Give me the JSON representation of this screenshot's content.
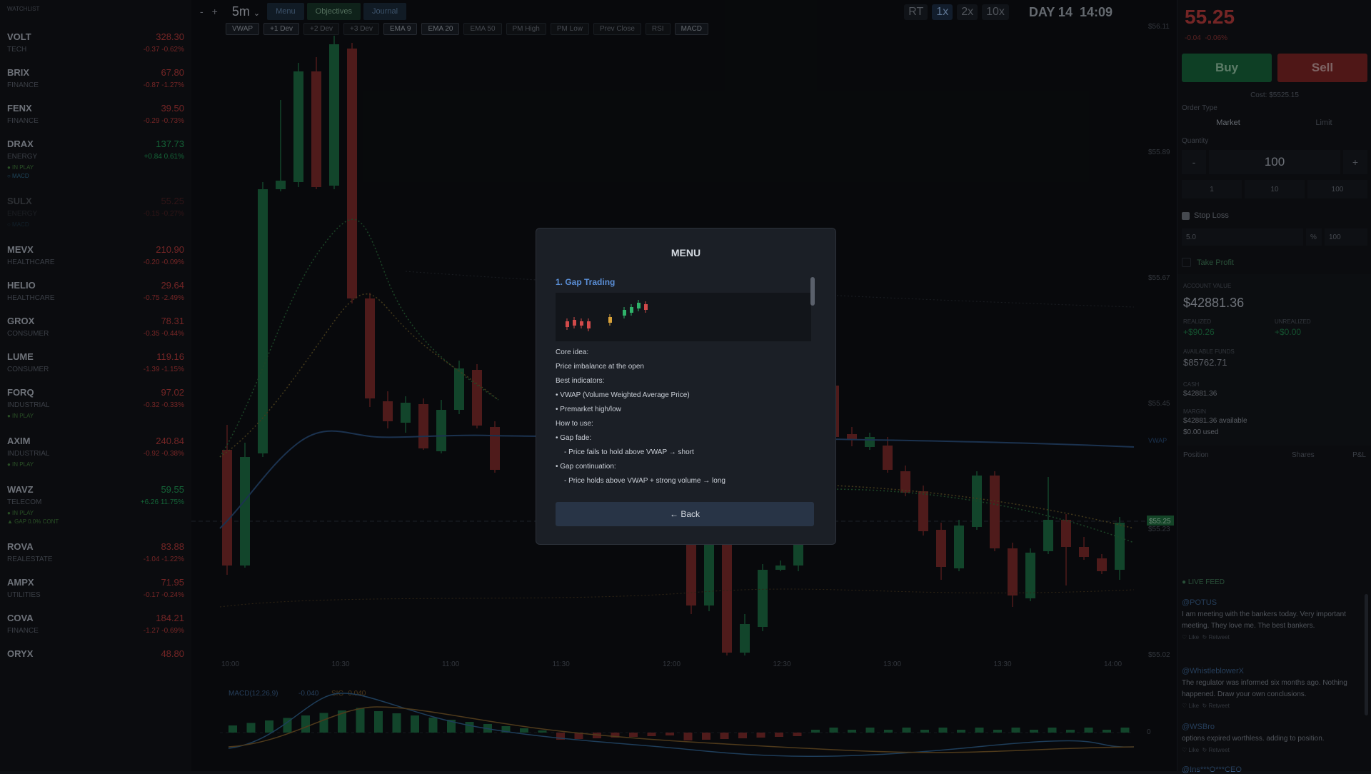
{
  "watchlist": {
    "header": "WATCHLIST",
    "items": [
      {
        "symbol": "VOLT",
        "sector": "TECH",
        "price": "328.30",
        "change": "-0.37 -0.62%",
        "dir": "down",
        "tags": []
      },
      {
        "symbol": "BRIX",
        "sector": "FINANCE",
        "price": "67.80",
        "change": "-0.87 -1.27%",
        "dir": "down",
        "tags": []
      },
      {
        "symbol": "FENX",
        "sector": "FINANCE",
        "price": "39.50",
        "change": "-0.29 -0.73%",
        "dir": "down",
        "tags": []
      },
      {
        "symbol": "DRAX",
        "sector": "ENERGY",
        "price": "137.73",
        "change": "+0.84 0.61%",
        "dir": "up",
        "tags": [
          "● IN PLAY",
          "○ MACD"
        ]
      },
      {
        "symbol": "SULX",
        "sector": "ENERGY",
        "price": "55.25",
        "change": "-0.15 -0.27%",
        "dir": "down",
        "tags": [
          "○ MACD"
        ],
        "selected": true
      },
      {
        "symbol": "MEVX",
        "sector": "HEALTHCARE",
        "price": "210.90",
        "change": "-0.20 -0.09%",
        "dir": "down",
        "tags": []
      },
      {
        "symbol": "HELIO",
        "sector": "HEALTHCARE",
        "price": "29.64",
        "change": "-0.75 -2.49%",
        "dir": "down",
        "tags": []
      },
      {
        "symbol": "GROX",
        "sector": "CONSUMER",
        "price": "78.31",
        "change": "-0.35 -0.44%",
        "dir": "down",
        "tags": []
      },
      {
        "symbol": "LUME",
        "sector": "CONSUMER",
        "price": "119.16",
        "change": "-1.39 -1.15%",
        "dir": "down",
        "tags": []
      },
      {
        "symbol": "FORQ",
        "sector": "INDUSTRIAL",
        "price": "97.02",
        "change": "-0.32 -0.33%",
        "dir": "down",
        "tags": [
          "● IN PLAY"
        ]
      },
      {
        "symbol": "AXIM",
        "sector": "INDUSTRIAL",
        "price": "240.84",
        "change": "-0.92 -0.38%",
        "dir": "down",
        "tags": [
          "● IN PLAY"
        ]
      },
      {
        "symbol": "WAVZ",
        "sector": "TELECOM",
        "price": "59.55",
        "change": "+6.26 11.75%",
        "dir": "up",
        "tags": [
          "● IN PLAY",
          "▲ GAP 0.0% CONT"
        ]
      },
      {
        "symbol": "ROVA",
        "sector": "REALESTATE",
        "price": "83.88",
        "change": "-1.04 -1.22%",
        "dir": "down",
        "tags": []
      },
      {
        "symbol": "AMPX",
        "sector": "UTILITIES",
        "price": "71.95",
        "change": "-0.17 -0.24%",
        "dir": "down",
        "tags": []
      },
      {
        "symbol": "COVA",
        "sector": "FINANCE",
        "price": "184.21",
        "change": "-1.27 -0.69%",
        "dir": "down",
        "tags": []
      },
      {
        "symbol": "ORYX",
        "sector": "",
        "price": "48.80",
        "change": "",
        "dir": "down",
        "tags": []
      }
    ]
  },
  "toolbar": {
    "minus": "-",
    "plus": "+",
    "timeframe": "5m",
    "tabs": [
      "Menu",
      "Objectives",
      "Journal"
    ],
    "indicators": [
      "VWAP",
      "+1 Dev",
      "+2 Dev",
      "+3 Dev",
      "EMA 9",
      "EMA 20",
      "EMA 50",
      "PM High",
      "PM Low",
      "Prev Close",
      "RSI",
      "MACD"
    ],
    "speeds": [
      "RT",
      "1x",
      "2x",
      "10x"
    ],
    "day": "DAY 14  14:09"
  },
  "chart": {
    "price_labels": [
      "$56.11",
      "$55.89",
      "$55.67",
      "$55.45",
      "$55.23",
      "$55.02"
    ],
    "current_price_tag": "$55.25",
    "vwap_label": "VWAP",
    "time_labels": [
      "10:00",
      "10:30",
      "11:00",
      "11:30",
      "12:00",
      "12:30",
      "13:00",
      "13:30",
      "14:00"
    ],
    "macd_label": "MACD(12,26,9)",
    "macd_value": "-0.040",
    "sig_value": "SIG -0.040",
    "zero_label": "0",
    "colors": {
      "up": "#1c6b43",
      "down": "#7a2a2a",
      "vwap": "#2a4d7a",
      "ema_up": "#2c6a3c",
      "ema_red": "#7a3a2a"
    }
  },
  "panel": {
    "price": "55.25",
    "change": "-0.04  -0.06%",
    "buy": "Buy",
    "sell": "Sell",
    "cost": "Cost: $5525.15",
    "order_type_label": "Order Type",
    "order_types": [
      "Market",
      "Limit"
    ],
    "quantity_label": "Quantity",
    "qty_minus": "-",
    "qty_value": "100",
    "qty_plus": "+",
    "presets": [
      "1",
      "10",
      "100"
    ],
    "stop_loss": "Stop Loss",
    "sl_value": "5.0",
    "sl_unit": "%",
    "sl_qty": "100",
    "take_profit": "Take Profit",
    "account": {
      "value_label": "ACCOUNT VALUE",
      "value": "$42881.36",
      "realized_label": "REALIZED",
      "realized": "+$90.26",
      "unrealized_label": "UNREALIZED",
      "unrealized": "+$0.00",
      "funds_label": "AVAILABLE FUNDS",
      "funds": "$85762.71",
      "cash_label": "CASH",
      "cash": "$42881.36",
      "margin_label": "MARGIN",
      "margin_avail": "$42881.36 available",
      "margin_used": "$0.00 used"
    },
    "position_headers": [
      "Position",
      "Shares",
      "P&L"
    ],
    "feed_header": "● LIVE FEED",
    "feed": [
      {
        "user": "@POTUS",
        "text": "I am meeting with the bankers today. Very important meeting. They love me. The best bankers.",
        "like": "♡ Like",
        "retweet": "↻ Retweet"
      },
      {
        "user": "@WhistleblowerX",
        "text": "The regulator was informed six months ago. Nothing happened. Draw your own conclusions.",
        "like": "♡ Like",
        "retweet": "↻ Retweet"
      },
      {
        "user": "@WSBro",
        "text": "options expired worthless. adding to position.",
        "like": "♡ Like",
        "retweet": "↻ Retweet"
      },
      {
        "user": "@Ins***O***CEO",
        "text": "",
        "like": "",
        "retweet": ""
      }
    ]
  },
  "modal": {
    "title": "MENU",
    "section_title": "1. Gap Trading",
    "lines": [
      {
        "t": "Core idea:",
        "sub": false
      },
      {
        "t": "Price imbalance at the open",
        "sub": false
      },
      {
        "t": "Best indicators:",
        "sub": false
      },
      {
        "t": "• VWAP (Volume Weighted Average Price)",
        "sub": false
      },
      {
        "t": "• Premarket high/low",
        "sub": false
      },
      {
        "t": "How to use:",
        "sub": false
      },
      {
        "t": "• Gap fade:",
        "sub": false
      },
      {
        "t": "- Price fails to hold above VWAP → short",
        "sub": true
      },
      {
        "t": "• Gap continuation:",
        "sub": false
      },
      {
        "t": "- Price holds above VWAP + strong volume → long",
        "sub": true
      }
    ],
    "back": "← Back"
  }
}
